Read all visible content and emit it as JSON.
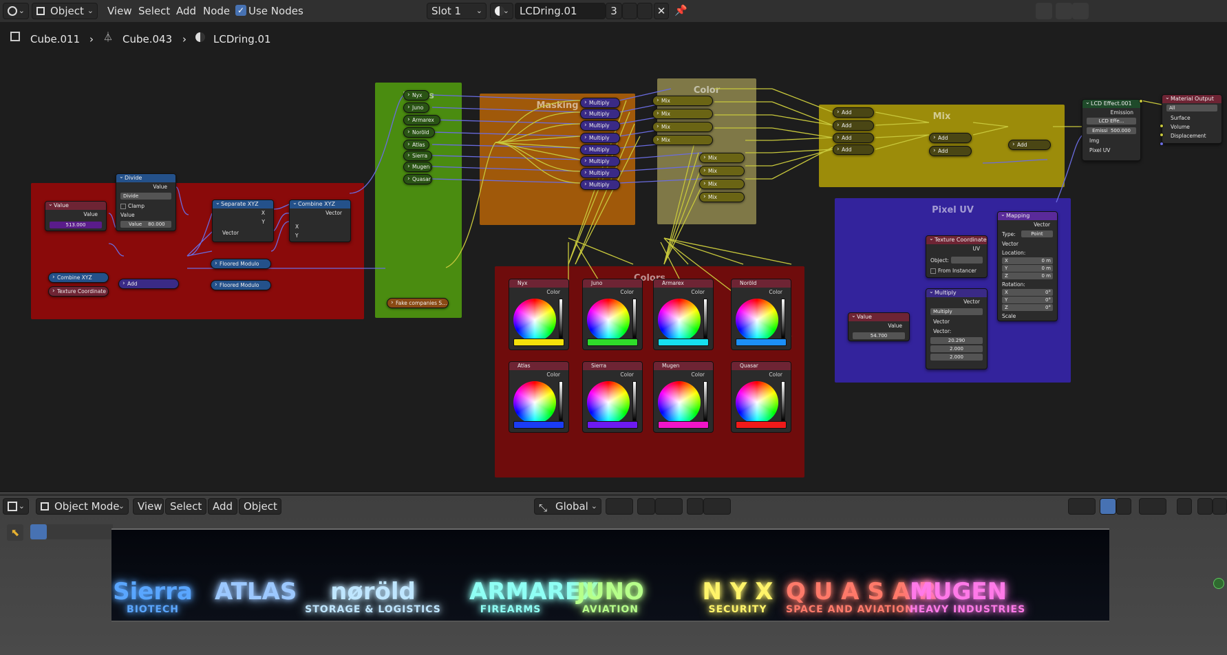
{
  "header": {
    "editor_type_label": "",
    "object_dropdown": "Object",
    "menus": [
      "View",
      "Select",
      "Add",
      "Node"
    ],
    "use_nodes_label": "Use Nodes",
    "use_nodes_checked": true,
    "slot": "Slot 1",
    "material_name": "LCDring.01",
    "user_count": "3"
  },
  "breadcrumb": {
    "object": "Cube.011",
    "mesh": "Cube.043",
    "material": "LCDring.01"
  },
  "frames": {
    "masks": "Masks",
    "masking": "Masking",
    "color": "Color",
    "mix": "Mix",
    "pixel_uv": "Pixel UV",
    "colors": "Colors"
  },
  "nodes": {
    "value1": {
      "title": "Value",
      "out": "Value",
      "val": "513.000"
    },
    "divide": {
      "title": "Divide",
      "out": "Value",
      "mode": "Divide",
      "clamp": "Clamp",
      "in1": "Value",
      "in2_label": "Value",
      "in2_val": "80.000"
    },
    "separate": {
      "title": "Separate XYZ",
      "x": "X",
      "y": "Y",
      "in": "Vector"
    },
    "combine": {
      "title": "Combine XYZ",
      "out": "Vector",
      "x": "X",
      "y": "Y"
    },
    "combine2": "Combine XYZ",
    "texcoord_small": "Texture Coordinate",
    "add_small": "Add",
    "floored1": "Floored Modulo",
    "floored2": "Floored Modulo",
    "fake": "Fake companies S...",
    "mask_pills": [
      "Nyx",
      "Juno",
      "Armarex",
      "Noröld",
      "Atlas",
      "Sierra",
      "Mugen",
      "Quasar"
    ],
    "multiply_pills": [
      "Multiply",
      "Multiply",
      "Multiply",
      "Multiply",
      "Multiply",
      "Multiply",
      "Multiply",
      "Multiply"
    ],
    "mix_pills": [
      "Mix",
      "Mix",
      "Mix",
      "Mix",
      "Mix",
      "Mix",
      "Mix",
      "Mix"
    ],
    "add_pills": [
      "Add",
      "Add",
      "Add",
      "Add",
      "Add",
      "Add",
      "Add"
    ],
    "lcd": {
      "title": "LCD Effect.001",
      "out": "Emission",
      "group": "LCD Effe...",
      "emiss": "Emissi",
      "emiss_val": "500.000",
      "img": "Img",
      "pixel_uv": "Pixel UV"
    },
    "output": {
      "title": "Material Output",
      "target": "All",
      "surface": "Surface",
      "volume": "Volume",
      "displacement": "Displacement"
    },
    "mapping": {
      "title": "Mapping",
      "out": "Vector",
      "type_label": "Type:",
      "type": "Point",
      "vector": "Vector",
      "location": "Location:",
      "x": "X",
      "y": "Y",
      "z": "Z",
      "loc_x": "0 m",
      "loc_y": "0 m",
      "loc_z": "0 m",
      "rotation": "Rotation:",
      "rot_x": "0°",
      "rot_y": "0°",
      "rot_z": "0°",
      "scale": "Scale"
    },
    "texcoord": {
      "title": "Texture Coordinate",
      "uv": "UV",
      "object": "Object:",
      "from_instancer": "From Instancer"
    },
    "multiply": {
      "title": "Multiply",
      "out": "Vector",
      "mode": "Multiply",
      "vec1": "Vector",
      "vec2": "Vector:",
      "v1": "20.290",
      "v2": "2.000",
      "v3": "2.000"
    },
    "value2": {
      "title": "Value",
      "out": "Value",
      "val": "54.700"
    }
  },
  "color_nodes": [
    {
      "name": "Nyx",
      "label": "Color",
      "swatch": "#f5e10a"
    },
    {
      "name": "Juno",
      "label": "Color",
      "swatch": "#2fdc2a"
    },
    {
      "name": "Armarex",
      "label": "Color",
      "swatch": "#16e0f0"
    },
    {
      "name": "Noröld",
      "label": "Color",
      "swatch": "#1c8ff7"
    },
    {
      "name": "Atlas",
      "label": "Color",
      "swatch": "#1b3cf4"
    },
    {
      "name": "Sierra",
      "label": "Color",
      "swatch": "#6d1af2"
    },
    {
      "name": "Mugen",
      "label": "Color",
      "swatch": "#f015c8"
    },
    {
      "name": "Quasar",
      "label": "Color",
      "swatch": "#f01a1a"
    }
  ],
  "viewport": {
    "mode": "Object Mode",
    "menus": [
      "View",
      "Select",
      "Add",
      "Object"
    ],
    "orientation": "Global"
  },
  "sign": [
    {
      "big": "Sierra",
      "small": "BIOTECH",
      "color": "#5aa6ff"
    },
    {
      "big": "ATLAS",
      "small": "",
      "color": "#9cc8ff"
    },
    {
      "big": "nøröld",
      "small": "STORAGE & LOGISTICS",
      "color": "#bfe6ff"
    },
    {
      "big": "ARMAREX",
      "small": "FIREARMS",
      "color": "#8ffff4"
    },
    {
      "big": "JUNO",
      "small": "AVIATION",
      "color": "#b6ff8a"
    },
    {
      "big": "N Y X",
      "small": "SECURITY",
      "color": "#fff46a"
    },
    {
      "big": "Q U A S A R",
      "small": "SPACE AND AVIATION",
      "color": "#ff7a6a"
    },
    {
      "big": "MUGEN",
      "small": "HEAVY INDUSTRIES",
      "color": "#ff7ae8"
    }
  ]
}
